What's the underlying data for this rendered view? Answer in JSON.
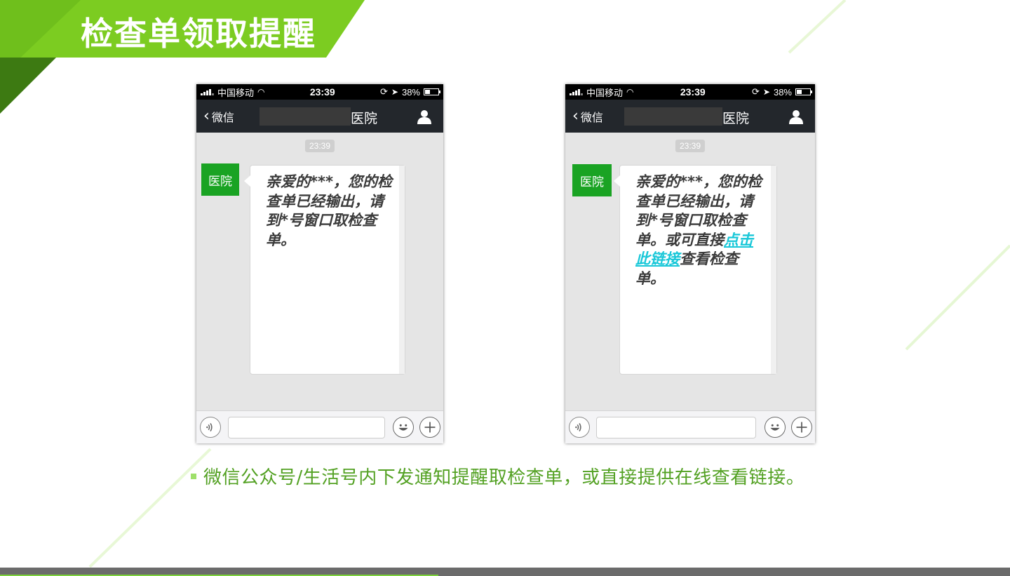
{
  "page": {
    "title": "检查单领取提醒",
    "caption": "微信公众号/生活号内下发通知提醒取检查单，或直接提供在线查看链接。",
    "colors": {
      "accent_green": "#7ccc21",
      "dark_green": "#3d7a12",
      "caption_green": "#53a123",
      "link_cyan": "#17c7d8"
    }
  },
  "phones": [
    {
      "status": {
        "carrier": "中国移动",
        "time": "23:39",
        "battery": "38%"
      },
      "nav": {
        "back_label": "微信",
        "title": "医院"
      },
      "chat": {
        "time_stamp": "23:39",
        "avatar_label": "医院",
        "message_text": "亲爱的***，您的检查单已经输出，请到*号窗口取检查单。"
      }
    },
    {
      "status": {
        "carrier": "中国移动",
        "time": "23:39",
        "battery": "38%"
      },
      "nav": {
        "back_label": "微信",
        "title": "医院"
      },
      "chat": {
        "time_stamp": "23:39",
        "avatar_label": "医院",
        "message_before": "亲爱的***，您的检查单已经输出，请到*号窗口取检查单。或可直接",
        "link_text": "点击此链接",
        "message_after": "查看检查单。"
      }
    }
  ]
}
